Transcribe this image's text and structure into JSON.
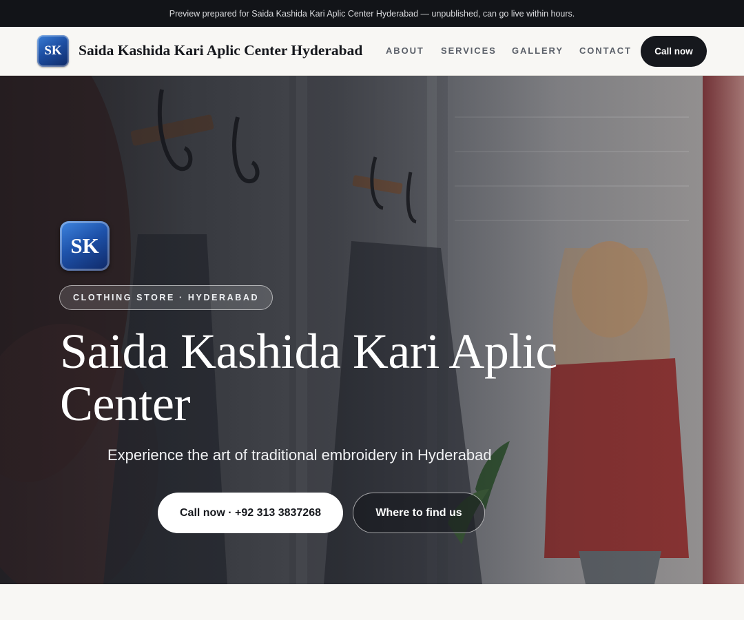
{
  "preview_banner": {
    "text": "Preview prepared for Saida Kashida Kari Aplic Center Hyderabad — unpublished, can go live within hours."
  },
  "header": {
    "logo_text": "SK",
    "brand_name": "Saida Kashida Kari Aplic Center Hyderabad",
    "nav": [
      {
        "label": "ABOUT"
      },
      {
        "label": "SERVICES"
      },
      {
        "label": "GALLERY"
      },
      {
        "label": "CONTACT"
      }
    ],
    "cta_label": "Call now"
  },
  "hero": {
    "logo_text": "SK",
    "badge": "CLOTHING STORE · HYDERABAD",
    "title": "Saida Kashida Kari Aplic Center",
    "subtitle": "Experience the art of traditional embroidery in Hyderabad",
    "primary_cta": "Call now · +92 313 3837268",
    "secondary_cta": "Where to find us"
  },
  "colors": {
    "top_bar": "#121418",
    "header_bg": "#f8f7f4",
    "dark_button": "#16181d",
    "logo_blue": "#1d4fa3"
  }
}
